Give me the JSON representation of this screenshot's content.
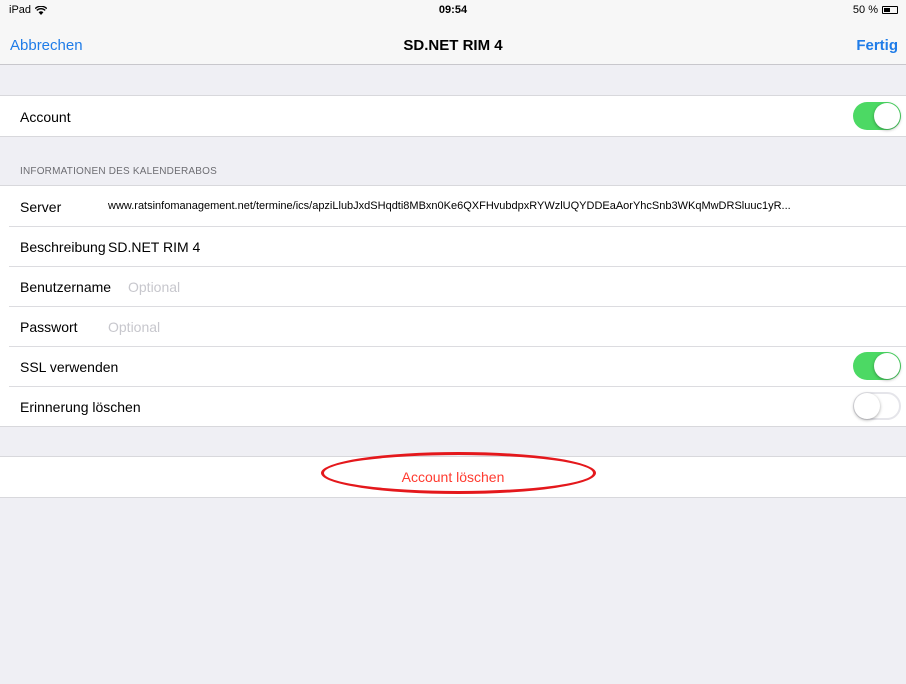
{
  "status_bar": {
    "device": "iPad",
    "time": "09:54",
    "battery": "50 %",
    "battery_level": 0.5
  },
  "nav": {
    "cancel_label": "Abbrechen",
    "title": "SD.NET RIM 4",
    "done_label": "Fertig"
  },
  "account_row": {
    "label": "Account",
    "enabled": true
  },
  "section_header": "INFORMATIONEN DES KALENDERABOS",
  "fields": {
    "server_label": "Server",
    "server_value": "www.ratsinfomanagement.net/termine/ics/apziLlubJxdSHqdti8MBxn0Ke6QXFHvubdpxRYWzlUQYDDEaAorYhcSnb3WKqMwDRSluuc1yR...",
    "description_label": "Beschreibung",
    "description_value": "SD.NET RIM 4",
    "username_label": "Benutzername",
    "username_placeholder": "Optional",
    "password_label": "Passwort",
    "password_placeholder": "Optional",
    "ssl_label": "SSL verwenden",
    "ssl_enabled": true,
    "reminder_label": "Erinnerung löschen",
    "reminder_enabled": false
  },
  "delete_account_label": "Account löschen",
  "colors": {
    "accent": "#1f7ce8",
    "switch_on": "#4cd964",
    "destructive": "#ff3b30",
    "annotation": "#e4181c",
    "background": "#efeff4"
  }
}
